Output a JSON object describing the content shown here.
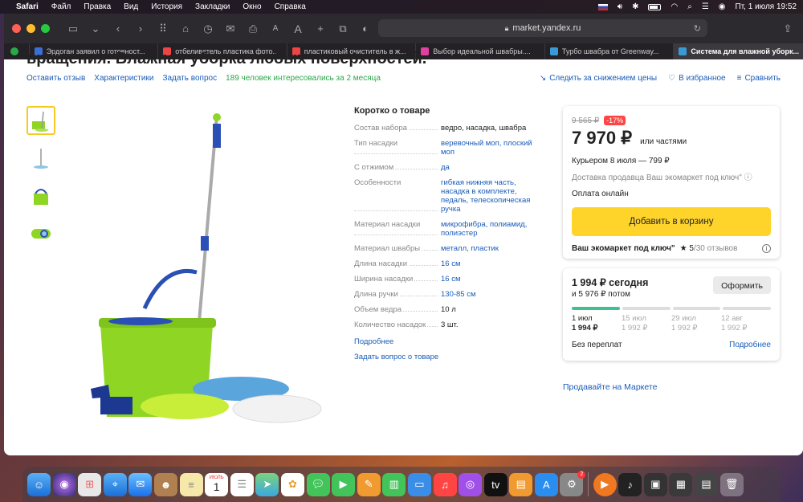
{
  "menubar": {
    "app": "Safari",
    "items": [
      "Файл",
      "Правка",
      "Вид",
      "История",
      "Закладки",
      "Окно",
      "Справка"
    ],
    "clock": "Пт, 1 июля  19:52"
  },
  "browser": {
    "url": "market.yandex.ru",
    "tabs": [
      {
        "title": "Эрдоган заявил о готовност...",
        "color": "#3a6fd8"
      },
      {
        "title": "отбеливатель пластика фото...",
        "color": "#e44"
      },
      {
        "title": "пластиковый очиститель в ж...",
        "color": "#e44"
      },
      {
        "title": "Выбор идеальной швабры....",
        "color": "#e040a0"
      },
      {
        "title": "Турбо швабра от Greenway...",
        "color": "#3a9ad8"
      },
      {
        "title": "Система для влажной уборк...",
        "color": "#3a9ad8"
      }
    ]
  },
  "product": {
    "title_clip": "вращения. Влажная уборка любых поверхностей.",
    "subnav": {
      "reviews": "Оставить отзыв",
      "specs": "Характеристики",
      "question": "Задать вопрос",
      "interest": "189 человек интересовались за 2 месяца"
    },
    "actions": {
      "price_watch": "Следить за снижением цены",
      "favorites": "В избранное",
      "compare": "Сравнить"
    }
  },
  "specs": {
    "heading": "Коротко о товаре",
    "rows": [
      {
        "key": "Состав набора",
        "value": "ведро, насадка, швабра",
        "link": false
      },
      {
        "key": "Тип насадки",
        "value": "веревочный моп, плоский моп",
        "link": true
      },
      {
        "key": "С отжимом",
        "value": "да",
        "link": true
      },
      {
        "key": "Особенности",
        "value": "гибкая нижняя часть, насадка в комплекте, педаль, телескопическая ручка",
        "link": true
      },
      {
        "key": "Материал насадки",
        "value": "микрофибра, полиамид, полиэстер",
        "link": true
      },
      {
        "key": "Материал швабры",
        "value": "металл, пластик",
        "link": true
      },
      {
        "key": "Длина насадки",
        "value": "16 см",
        "link": true
      },
      {
        "key": "Ширина насадки",
        "value": "16 см",
        "link": true
      },
      {
        "key": "Длина ручки",
        "value": "130-85 см",
        "link": true
      },
      {
        "key": "Объем ведра",
        "value": "10 л",
        "link": false
      },
      {
        "key": "Количество насадок",
        "value": "3 шт.",
        "link": false
      }
    ],
    "more": "Подробнее",
    "ask": "Задать вопрос о товаре"
  },
  "buybox": {
    "old_price": "9 565 ₽",
    "discount": "-17%",
    "price": "7 970 ₽",
    "parts": "или частями",
    "courier": "Курьером 8 июля — 799 ₽",
    "delivery": "Доставка продавца Ваш экомаркет под ключ\"",
    "payment": "Оплата онлайн",
    "cart_button": "Добавить в корзину",
    "seller_name": "Ваш экомаркет под ключ\"",
    "seller_rating": "5",
    "seller_reviews": "/30 отзывов"
  },
  "split": {
    "today": "1 994 ₽ сегодня",
    "then": "и 5 976 ₽ потом",
    "checkout_button": "Оформить",
    "payments": [
      {
        "date": "1 июл",
        "amount": "1 994 ₽"
      },
      {
        "date": "15 июл",
        "amount": "1 992 ₽"
      },
      {
        "date": "29 июл",
        "amount": "1 992 ₽"
      },
      {
        "date": "12 авг",
        "amount": "1 992 ₽"
      }
    ],
    "no_overpay": "Без переплат",
    "more": "Подробнее"
  },
  "sell_link": "Продавайте на Маркете",
  "dock": {
    "calendar_month": "ИЮЛЬ",
    "calendar_day": "1",
    "badge_count": "2"
  }
}
